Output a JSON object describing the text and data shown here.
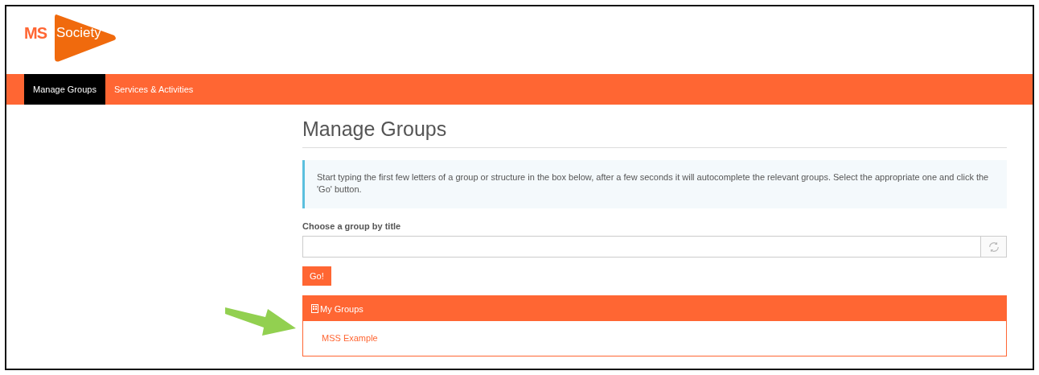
{
  "logo": {
    "mark": "MS",
    "word": "Society"
  },
  "nav": [
    {
      "label": "Manage Groups",
      "selected": true
    },
    {
      "label": "Services & Activities",
      "selected": false
    }
  ],
  "page_title": "Manage Groups",
  "info": "Start typing the first few letters of a group or structure in the box below, after a few seconds it will autocomplete the relevant groups. Select the appropriate one and click the 'Go' button.",
  "group_field": {
    "label": "Choose a group by title"
  },
  "go_button": "Go!",
  "my_groups": {
    "title": "My Groups",
    "items": [
      "MSS Example"
    ]
  },
  "annotation": {
    "kind": "arrow"
  }
}
